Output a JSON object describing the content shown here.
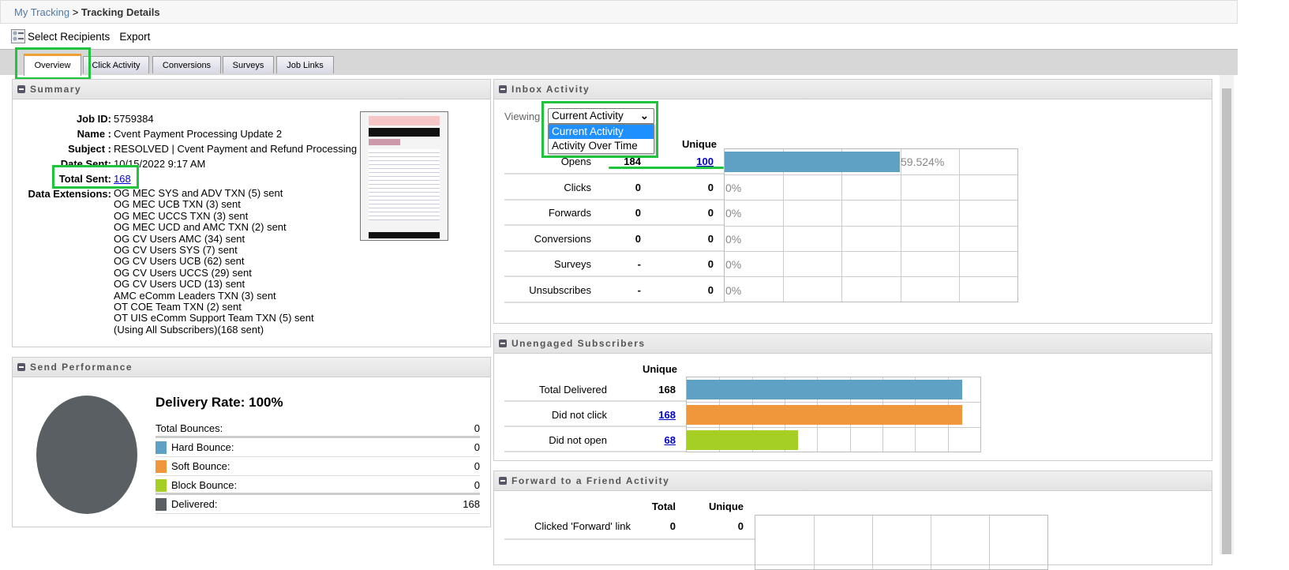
{
  "breadcrumb": {
    "parent": "My Tracking",
    "separator": " > ",
    "current": "Tracking Details"
  },
  "toolbar": {
    "select_recipients": "Select Recipients",
    "export": "Export"
  },
  "tabs": [
    "Overview",
    "Click Activity",
    "Conversions",
    "Surveys",
    "Job Links"
  ],
  "summary": {
    "title": "Summary",
    "fields": [
      {
        "label": "Job ID:",
        "value": "5759384"
      },
      {
        "label": "Name :",
        "value": "Cvent Payment Processing Update 2"
      },
      {
        "label": "Subject :",
        "value": "RESOLVED | Cvent Payment and Refund Processing"
      },
      {
        "label": "Date Sent:",
        "value": "10/15/2022 9:17 AM"
      },
      {
        "label": "Total Sent:",
        "value": "168"
      },
      {
        "label": "Data Extensions:",
        "value": ""
      }
    ],
    "extensions": [
      "OG MEC SYS and ADV TXN (5) sent",
      "OG MEC UCB TXN (3) sent",
      "OG MEC UCCS TXN (3) sent",
      "OG MEC UCD and AMC TXN (2) sent",
      "OG CV Users AMC (34) sent",
      "OG CV Users SYS (7) sent",
      "OG CV Users UCB (62) sent",
      "OG CV Users UCCS (29) sent",
      "OG CV Users UCD (13) sent",
      "AMC eComm Leaders TXN (3) sent",
      "OT COE Team TXN (2) sent",
      "OT UIS eComm Support Team TXN (5) sent",
      "(Using All Subscribers)(168 sent)"
    ]
  },
  "send_performance": {
    "title": "Send Performance",
    "delivery_rate": "Delivery Rate: 100%",
    "rows": [
      {
        "label": "Total Bounces:",
        "value": "0",
        "color": ""
      },
      {
        "label": "Hard Bounce:",
        "value": "0",
        "color": "#5fa0c5"
      },
      {
        "label": "Soft Bounce:",
        "value": "0",
        "color": "#ef973a"
      },
      {
        "label": "Block Bounce:",
        "value": "0",
        "color": "#a6cf26"
      },
      {
        "label": "Delivered:",
        "value": "168",
        "color": "#5a5f63"
      }
    ],
    "pie": {
      "delivered": 168,
      "bounced": 0,
      "color": "#5a5f63"
    }
  },
  "inbox": {
    "title": "Inbox Activity",
    "viewing_label": "Viewing",
    "select_value": "Current Activity",
    "options": [
      "Current Activity",
      "Activity Over Time"
    ],
    "unique_header": "Unique",
    "rows": [
      {
        "label": "Opens",
        "total": "184",
        "unique": "100",
        "pct": "59.524%",
        "pct_value": 59.524,
        "link": true
      },
      {
        "label": "Clicks",
        "total": "0",
        "unique": "0",
        "pct": "0%",
        "pct_value": 0
      },
      {
        "label": "Forwards",
        "total": "0",
        "unique": "0",
        "pct": "0%",
        "pct_value": 0
      },
      {
        "label": "Conversions",
        "total": "0",
        "unique": "0",
        "pct": "0%",
        "pct_value": 0
      },
      {
        "label": "Surveys",
        "total": "-",
        "unique": "0",
        "pct": "0%",
        "pct_value": 0
      },
      {
        "label": "Unsubscribes",
        "total": "-",
        "unique": "0",
        "pct": "0%",
        "pct_value": 0
      }
    ],
    "bar_color": "#5fa0c5"
  },
  "unengaged": {
    "title": "Unengaged Subscribers",
    "unique_header": "Unique",
    "axis_max": 180,
    "rows": [
      {
        "label": "Total Delivered",
        "value": "168",
        "n": 168,
        "color": "#5fa0c5",
        "link": false
      },
      {
        "label": "Did not click",
        "value": "168",
        "n": 168,
        "color": "#ef973a",
        "link": true
      },
      {
        "label": "Did not open",
        "value": "68",
        "n": 68,
        "color": "#a6cf26",
        "link": true
      }
    ]
  },
  "forward": {
    "title": "Forward to a Friend Activity",
    "total_header": "Total",
    "unique_header": "Unique",
    "rows": [
      {
        "label": "Clicked 'Forward' link",
        "total": "0",
        "unique": "0"
      }
    ]
  }
}
